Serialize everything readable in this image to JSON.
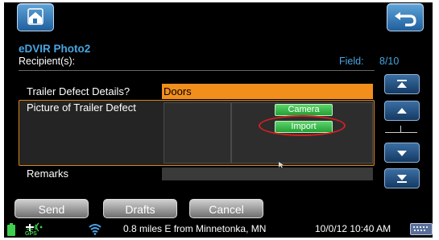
{
  "header": {
    "title": "eDVIR Photo2",
    "recipient_label": "Recipient(s):",
    "field_label": "Field:",
    "field_value": "8/10"
  },
  "form": {
    "trailer_defect_label": "Trailer Defect Details?",
    "trailer_defect_value": "Doors",
    "picture_label": "Picture of Trailer Defect",
    "camera_button": "Camera",
    "import_button": "Import",
    "remarks_label": "Remarks"
  },
  "toolbar": {
    "send_label": "Send",
    "drafts_label": "Drafts",
    "cancel_label": "Cancel"
  },
  "status_bar": {
    "gps_label": "GPS",
    "location": "0.8 miles E from Minnetonka, MN",
    "datetime": "10/0/12 10:40 AM"
  },
  "icons": {
    "home": "home-icon",
    "back": "back-arrow-icon",
    "scroll_top": "scroll-top-icon",
    "scroll_up": "scroll-up-icon",
    "scroll_down": "scroll-down-icon",
    "scroll_bottom": "scroll-bottom-icon",
    "battery": "battery-icon",
    "gps": "gps-icon",
    "wifi": "wifi-icon",
    "keyboard": "keyboard-icon"
  },
  "colors": {
    "accent_blue": "#46a6e2",
    "field_orange": "#f28e1c",
    "button_green": "#23a035",
    "highlight_red": "#d32020"
  }
}
